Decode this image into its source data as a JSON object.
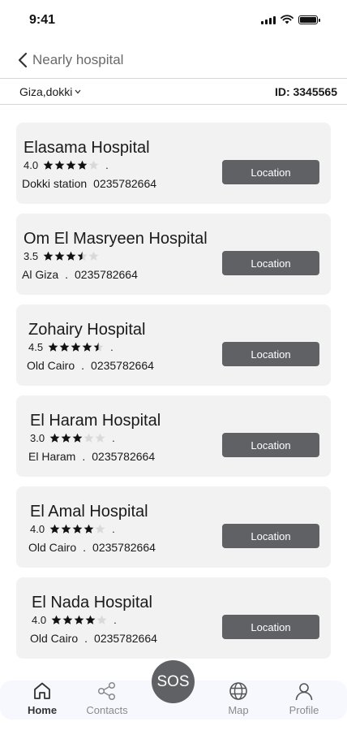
{
  "status_bar": {
    "time": "9:41"
  },
  "header": {
    "title": "Nearly hospital"
  },
  "info_bar": {
    "location": "Giza,dokki",
    "user_id": "ID: 3345565"
  },
  "button_label": "Location",
  "hospitals": [
    {
      "name": "Elasama Hospital",
      "rating": "4.0",
      "rating_value": 4.0,
      "area": "Dokki station",
      "phone": "0235782664"
    },
    {
      "name": "Om El Masryeen Hospital",
      "rating": "3.5",
      "rating_value": 3.5,
      "area": "Al Giza",
      "phone": "0235782664"
    },
    {
      "name": "Zohairy Hospital",
      "rating": "4.5",
      "rating_value": 4.5,
      "area": "Old Cairo",
      "phone": "0235782664"
    },
    {
      "name": "El Haram Hospital",
      "rating": "3.0",
      "rating_value": 3.0,
      "area": "El Haram",
      "phone": "0235782664"
    },
    {
      "name": "El Amal Hospital",
      "rating": "4.0",
      "rating_value": 4.0,
      "area": "Old Cairo",
      "phone": "0235782664"
    },
    {
      "name": "El Nada Hospital",
      "rating": "4.0",
      "rating_value": 4.0,
      "area": "Old Cairo",
      "phone": "0235782664"
    }
  ],
  "bottom_nav": {
    "home": "Home",
    "contacts": "Contacts",
    "sos": "SOS",
    "map": "Map",
    "profile": "Profile"
  },
  "colors": {
    "button": "#5f6164",
    "card": "#f2f2f2",
    "nav_bg": "#f6f8fd"
  }
}
